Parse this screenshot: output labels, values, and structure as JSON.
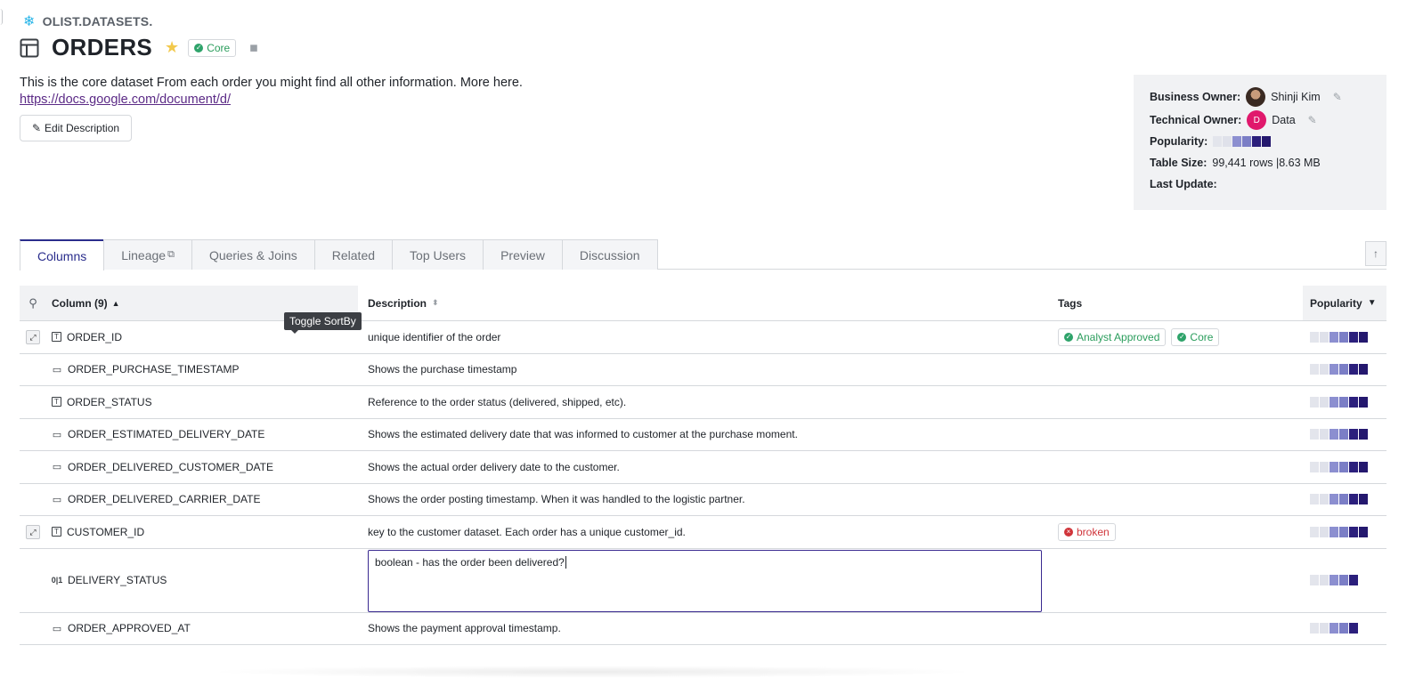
{
  "breadcrumb": {
    "path": "OLIST.DATASETS."
  },
  "header": {
    "title": "ORDERS",
    "badge": "Core"
  },
  "description": {
    "text": "This is the core dataset From each order you might find all other information. More here.",
    "link": "https://docs.google.com/document/d/",
    "edit_label": "Edit Description"
  },
  "meta": {
    "business_owner_label": "Business Owner:",
    "business_owner": "Shinji Kim",
    "technical_owner_label": "Technical Owner:",
    "technical_owner_initial": "D",
    "technical_owner": "Data",
    "popularity_label": "Popularity:",
    "table_size_label": "Table Size:",
    "table_size": "99,441 rows |8.63 MB",
    "last_update_label": "Last Update:",
    "last_update": ""
  },
  "tabs": [
    "Columns",
    "Lineage",
    "Queries & Joins",
    "Related",
    "Top Users",
    "Preview",
    "Discussion"
  ],
  "tooltip": "Toggle SortBy",
  "grid": {
    "headers": {
      "column": "Column (9)",
      "description": "Description",
      "tags": "Tags",
      "popularity": "Popularity"
    },
    "rows": [
      {
        "name": "ORDER_ID",
        "type": "text",
        "desc": "unique identifier of the order",
        "tags": [
          "Analyst Approved",
          "Core"
        ],
        "popularity": 6
      },
      {
        "name": "ORDER_PURCHASE_TIMESTAMP",
        "type": "date",
        "desc": "Shows the purchase timestamp",
        "tags": [],
        "popularity": 6
      },
      {
        "name": "ORDER_STATUS",
        "type": "text",
        "desc": "Reference to the order status (delivered, shipped, etc).",
        "tags": [],
        "popularity": 6
      },
      {
        "name": "ORDER_ESTIMATED_DELIVERY_DATE",
        "type": "date",
        "desc": "Shows the estimated delivery date that was informed to customer at the purchase moment.",
        "tags": [],
        "popularity": 6
      },
      {
        "name": "ORDER_DELIVERED_CUSTOMER_DATE",
        "type": "date",
        "desc": "Shows the actual order delivery date to the customer.",
        "tags": [],
        "popularity": 6
      },
      {
        "name": "ORDER_DELIVERED_CARRIER_DATE",
        "type": "date",
        "desc": "Shows the order posting timestamp. When it was handled to the logistic partner.",
        "tags": [],
        "popularity": 6
      },
      {
        "name": "CUSTOMER_ID",
        "type": "text",
        "desc": "key to the customer dataset. Each order has a unique customer_id.",
        "tags": [
          "broken"
        ],
        "popularity": 6
      },
      {
        "name": "DELIVERY_STATUS",
        "type": "boolean",
        "desc": "boolean - has the order been delivered?",
        "tags": [],
        "popularity": 5
      },
      {
        "name": "ORDER_APPROVED_AT",
        "type": "date",
        "desc": "Shows the payment approval timestamp.",
        "tags": [],
        "popularity": 5
      }
    ]
  }
}
